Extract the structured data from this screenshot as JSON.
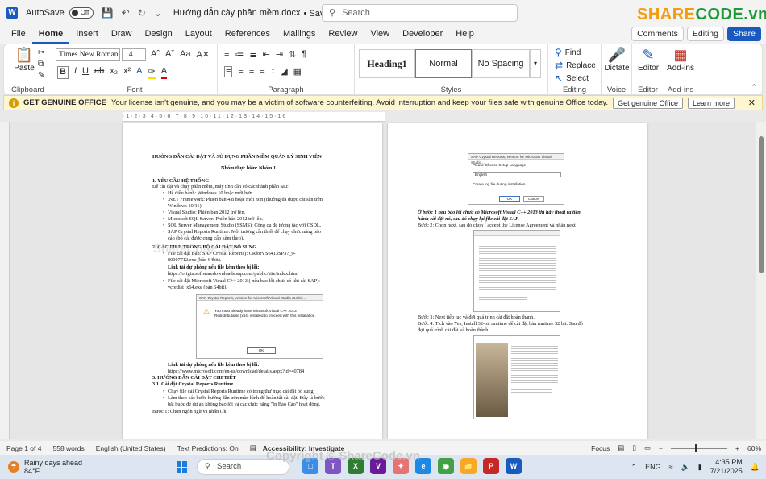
{
  "titlebar": {
    "autosave_label": "AutoSave",
    "autosave_state": "Off",
    "doc_title": "Hướng dẫn cày phần mềm.docx",
    "saved_state": "• Saved ⌄",
    "search_placeholder": "Search",
    "logo_text_a": "SHARE",
    "logo_text_b": "CODE.vn"
  },
  "menubar": {
    "items": [
      "File",
      "Home",
      "Insert",
      "Draw",
      "Design",
      "Layout",
      "References",
      "Mailings",
      "Review",
      "View",
      "Developer",
      "Help"
    ],
    "comments_label": "Comments",
    "editing_label": "Editing",
    "share_label": "Share"
  },
  "ribbon": {
    "clipboard": {
      "paste_label": "Paste",
      "group_label": "Clipboard"
    },
    "font": {
      "font_name": "Times New Roman",
      "font_size": "14",
      "group_label": "Font"
    },
    "paragraph": {
      "group_label": "Paragraph"
    },
    "styles": {
      "items": [
        "Heading1",
        "Normal",
        "No Spacing"
      ],
      "group_label": "Styles"
    },
    "editing": {
      "find_label": "Find",
      "replace_label": "Replace",
      "select_label": "Select",
      "group_label": "Editing"
    },
    "voice": {
      "dictate_label": "Dictate",
      "group_label": "Voice"
    },
    "editor": {
      "editor_label": "Editor",
      "group_label": "Editor"
    },
    "addins": {
      "addins_label": "Add-ins",
      "group_label": "Add-ins"
    }
  },
  "notice": {
    "title": "GET GENUINE OFFICE",
    "message": "Your license isn't genuine, and you may be a victim of software counterfeiting. Avoid interruption and keep your files safe with genuine Office today.",
    "get_button": "Get genuine Office",
    "learn_button": "Learn more"
  },
  "page1": {
    "title": "HƯỚNG DẪN CÀI ĐẶT VÀ SỬ DỤNG PHẦN MỀM QUẢN LÝ SINH VIÊN",
    "team": "Nhóm thực hiện: Nhóm 1",
    "s1": "1. YÊU CẦU HỆ THỐNG",
    "s1_intro": "Để cài đặt và chạy phần mềm, máy tính cần có các thành phần sau:",
    "req1": "Hệ điều hành: Windows 10 hoặc mới hơn.",
    "req2": ".NET Framework: Phiên bản 4.8 hoặc mới hơn (thường đã được cài sẵn trên",
    "req2b": "Windows 10/11).",
    "req3": "Visual Studio: Phiên bản 2012 trở lên.",
    "req4": "Microsoft SQL Server: Phiên bản 2012 trở lên.",
    "req5": "SQL Server Management Studio (SSMS): Công cụ để tương tác với CSDL.",
    "req6": "SAP Crystal Reports Runtime: Môi trường cần thiết để chạy chức năng báo",
    "req6b": "cáo (bộ cài được cung cấp kèm theo).",
    "s2": "2. CÁC FILE TRONG BỘ CÀI ĐẶT BỔ SUNG",
    "file1": "File cài đặt Bản: SAP Crystal Reports): CRforVS6413SP37_0-",
    "file1b": "80007712.exe (bản 64bit).",
    "link1_label": "Link tải dự phòng nếu file kèm theo bị lỗi:",
    "link1": "https://origin.softwaredownloads.sap.com/public/site/index.html",
    "file2": "File cài đặt Microsoft Visual C++ 2013 ( nếu báo lỗi chưa có khi cài SAP):",
    "file2b": "vcredist_x64.exe (bản 64bit).",
    "dlg_title": "SAP Crystal Reports, version for Microsoft Visual Studio (64-bit...",
    "dlg_msg": "You must already have Microsoft Visual C++ 2013 Redistributable (x64) installed to proceed with this installation.",
    "dlg_ok": "OK",
    "link2_label": "Link tải dự phòng nếu file kèm theo bị lỗi:",
    "link2": "https://www.microsoft.com/en-us/download/details.aspx?id=40784",
    "s3": "3. HƯỚNG DẪN CÀI ĐẶT CHI TIẾT",
    "s31": "3.1. Cài đặt Crystal Reports Runtime",
    "step_a": "Chạy file cài Crystal Reports Runtime có trong thư mục cài đặt bổ sung.",
    "step_b": "Làm theo các bước hướng dẫn trên màn hình để hoàn tất cài đặt. Đây là bước",
    "step_b2": "bắt buộc để dự án không báo lỗi và các chức năng \"In Báo Cáo\" hoạt động.",
    "step1": "Bước 1: Chọn ngôn ngữ và nhấn Ok"
  },
  "page2": {
    "note": "Ở bước 1 nếu báo lỗi chưa có Microsoft Visual C++ 2013 thì hãy thoát ra tiến",
    "note2": "hành cài đặt nó, sau đó chạy lại file cài đặt SAP.",
    "step2": "Bước 2: Chọn next, sau đó chọn I accept the License Agreement và nhấn next",
    "step3": "Bước 3: Next tiếp tục và đợi quá trình cài đặt hoàn thành.",
    "step4": "Bước 4. Tích vào Yes, Install 32-bit runtime để cài đặt bản runtime 32 bit. Sau đó",
    "step4b": "đợi quá trình cài đặt và hoàn thành.",
    "dlg1_title": "SAP Crystal Reports, version for Microsoft Visual Studio...",
    "dlg1_text": "Please Choose Setup Language",
    "dlg1_lang": "English",
    "dlg1_check": "Create log file during installation",
    "dlg1_ok": "OK",
    "dlg1_cancel": "Cancel"
  },
  "status": {
    "page": "Page 1 of 4",
    "words": "558 words",
    "language": "English (United States)",
    "predictions": "Text Predictions: On",
    "accessibility": "Accessibility: Investigate",
    "focus": "Focus",
    "zoom": "60%"
  },
  "taskbar": {
    "weather_title": "Rainy days ahead",
    "weather_temp": "84°F",
    "search": "Search",
    "lang": "ENG",
    "time": "4:35 PM",
    "date": "7/21/2025"
  },
  "watermark": "Copyright © ShareCode.vn",
  "watermark2": "ShareCode.vn"
}
